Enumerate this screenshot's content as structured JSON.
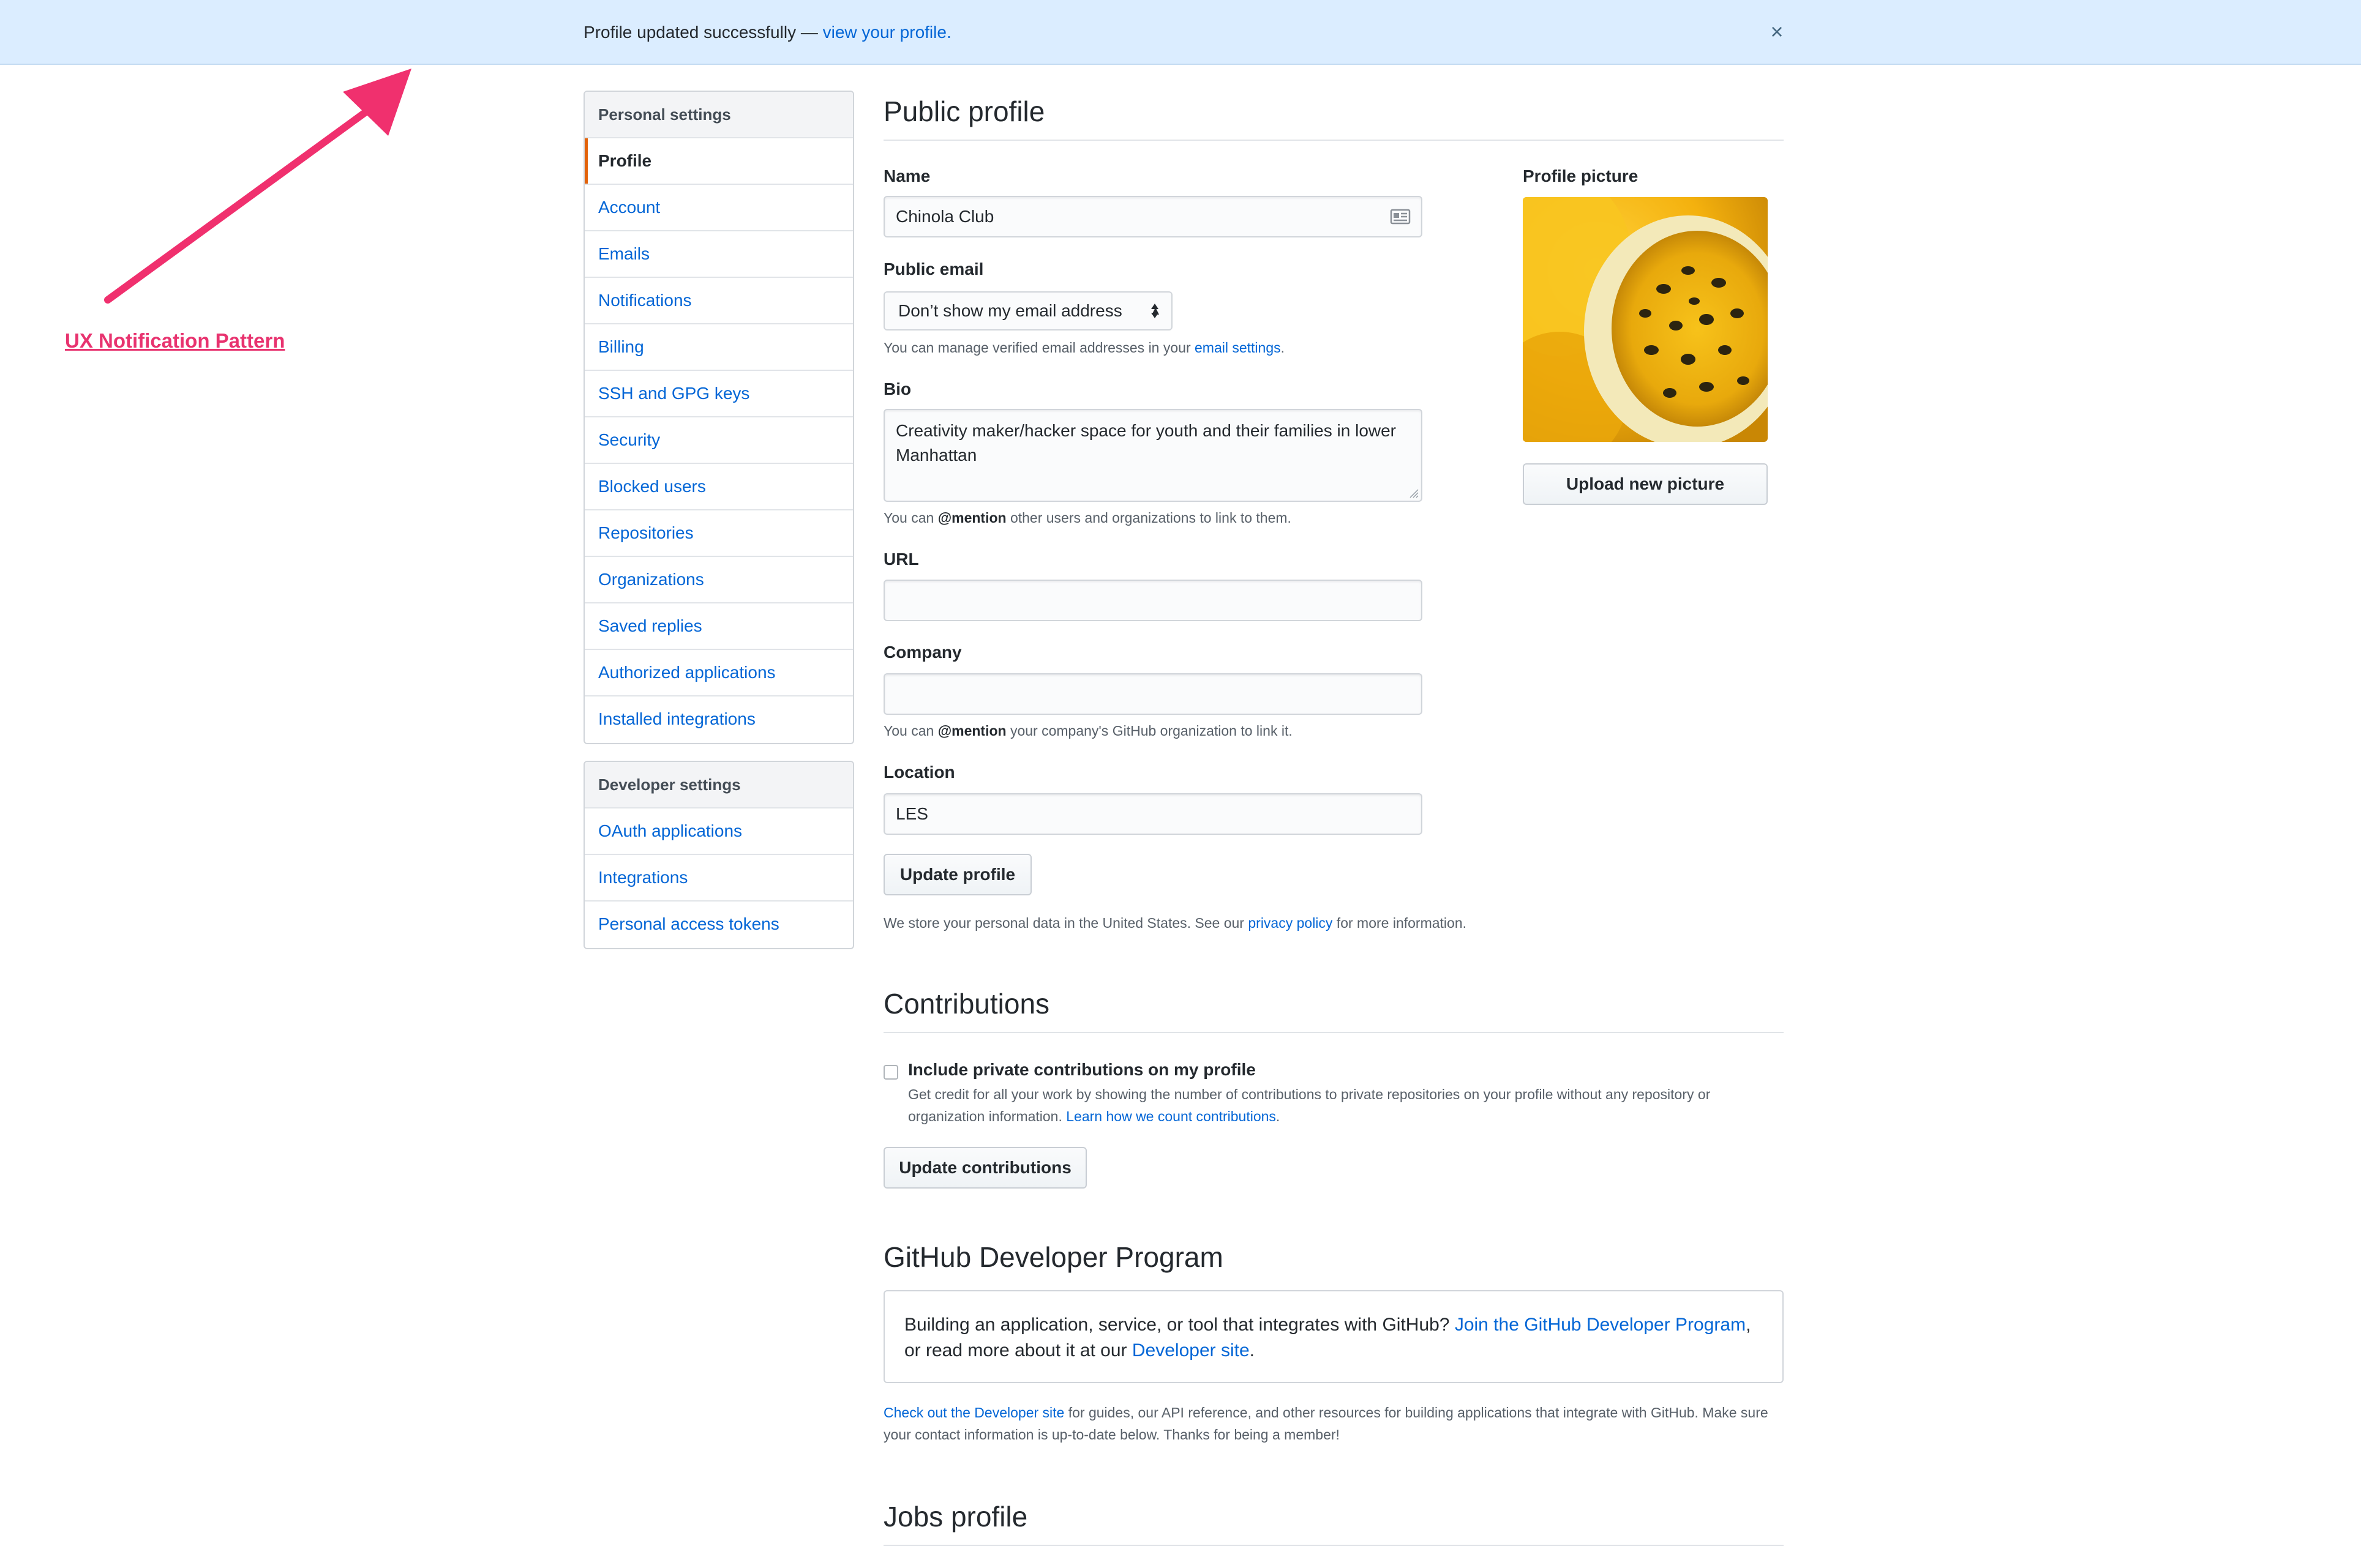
{
  "flash": {
    "message": "Profile updated successfully — ",
    "link": "view your profile.",
    "close_icon": "×"
  },
  "annotation": {
    "label": "UX Notification Pattern",
    "color": "#e8336f"
  },
  "sidebar": {
    "personal_heading": "Personal settings",
    "personal_items": [
      {
        "label": "Profile",
        "selected": true
      },
      {
        "label": "Account"
      },
      {
        "label": "Emails"
      },
      {
        "label": "Notifications"
      },
      {
        "label": "Billing"
      },
      {
        "label": "SSH and GPG keys"
      },
      {
        "label": "Security"
      },
      {
        "label": "Blocked users"
      },
      {
        "label": "Repositories"
      },
      {
        "label": "Organizations"
      },
      {
        "label": "Saved replies"
      },
      {
        "label": "Authorized applications"
      },
      {
        "label": "Installed integrations"
      }
    ],
    "developer_heading": "Developer settings",
    "developer_items": [
      {
        "label": "OAuth applications"
      },
      {
        "label": "Integrations"
      },
      {
        "label": "Personal access tokens"
      }
    ]
  },
  "public_profile": {
    "title": "Public profile",
    "name_label": "Name",
    "name_value": "Chinola Club",
    "email_label": "Public email",
    "email_selected": "Don’t show my email address",
    "email_note_prefix": "You can manage verified email addresses in your ",
    "email_note_link": "email settings",
    "email_note_suffix": ".",
    "bio_label": "Bio",
    "bio_value": "Creativity maker/hacker space for youth and their families in lower Manhattan",
    "bio_note_prefix": "You can ",
    "bio_note_mention": "@mention",
    "bio_note_suffix": " other users and organizations to link to them.",
    "url_label": "URL",
    "url_value": "",
    "company_label": "Company",
    "company_value": "",
    "company_note_prefix": "You can ",
    "company_note_mention": "@mention",
    "company_note_suffix": " your company's GitHub organization to link it.",
    "location_label": "Location",
    "location_value": "LES",
    "update_button": "Update profile",
    "privacy_prefix": "We store your personal data in the United States. See our ",
    "privacy_link": "privacy policy",
    "privacy_suffix": " for more information.",
    "picture_label": "Profile picture",
    "upload_button": "Upload new picture"
  },
  "contributions": {
    "title": "Contributions",
    "checkbox_label": "Include private contributions on my profile",
    "checked": false,
    "description": "Get credit for all your work by showing the number of contributions to private repositories on your profile without any repository or organization information. ",
    "learn_link": "Learn how we count contributions",
    "learn_suffix": ".",
    "update_button": "Update contributions"
  },
  "developer_program": {
    "title": "GitHub Developer Program",
    "box_prefix": "Building an application, service, or tool that integrates with GitHub? ",
    "box_join_link": "Join the GitHub Developer Program",
    "box_middle": ", or read more about it at our ",
    "box_site_link": "Developer site",
    "box_suffix": ".",
    "note_link": "Check out the Developer site",
    "note_text": " for guides, our API reference, and other resources for building applications that integrate with GitHub. Make sure your contact information is up-to-date below. Thanks for being a member!"
  },
  "jobs_profile": {
    "title": "Jobs profile"
  },
  "colors": {
    "accent": "#0366d6",
    "selected_marker": "#e36209",
    "flash_bg": "#dbedff"
  }
}
